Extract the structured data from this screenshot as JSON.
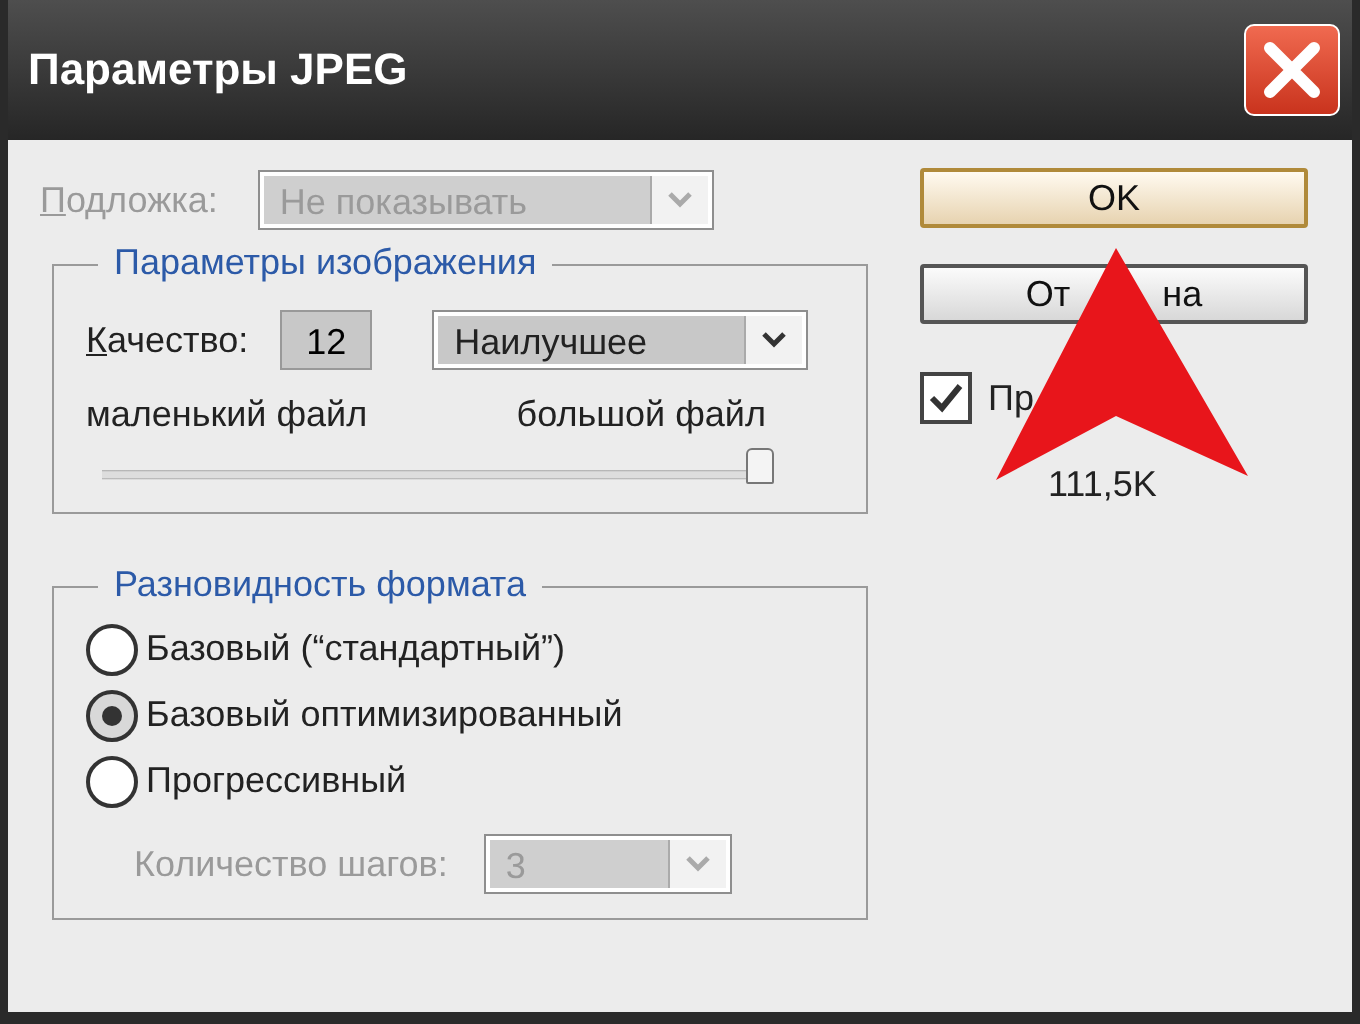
{
  "window": {
    "title": "Параметры JPEG"
  },
  "matte": {
    "label": "Подложка:",
    "value": "Не показывать",
    "disabled": true
  },
  "image_options": {
    "title": "Параметры изображения",
    "quality_label": "Качество:",
    "quality_value": "12",
    "quality_preset": "Наилучшее",
    "small_label": "маленький файл",
    "large_label": "большой файл",
    "slider": {
      "level": 1
    }
  },
  "format_options": {
    "title": "Разновидность формата",
    "options": [
      {
        "label": "Базовый (“стандартный”)",
        "selected": false
      },
      {
        "label": "Базовый оптимизированный",
        "selected": true
      },
      {
        "label": "Прогрессивный",
        "selected": false
      }
    ],
    "scans": {
      "label": "Количество шагов:",
      "value": "3",
      "disabled": true
    }
  },
  "buttons": [
    {
      "label_parts": [
        "OK"
      ],
      "default": true
    },
    {
      "label_parts": [
        "От",
        "на"
      ],
      "default": false
    }
  ],
  "preview": {
    "label": "Пр",
    "checked": true
  },
  "file_size": "111,5K"
}
